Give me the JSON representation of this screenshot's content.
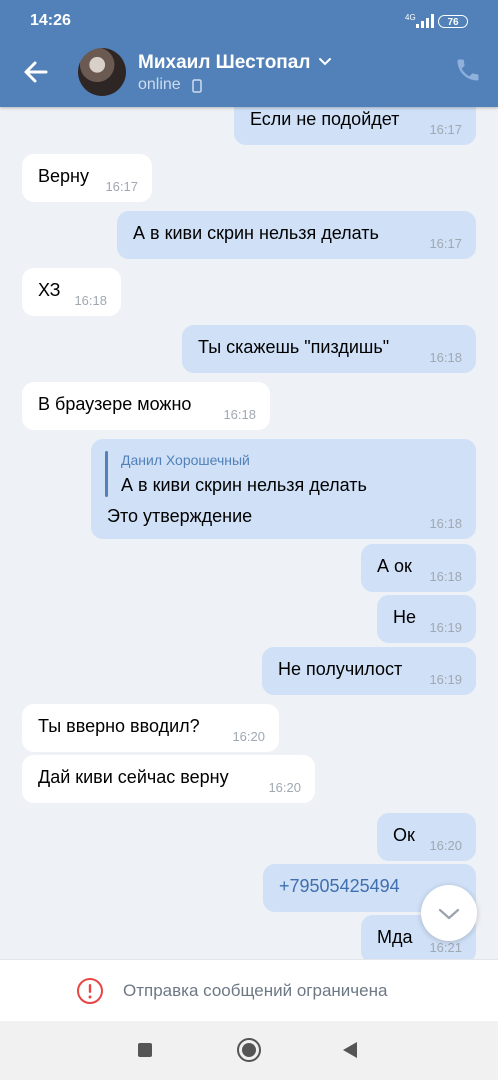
{
  "status_bar": {
    "time": "14:26",
    "network": "4G",
    "battery": "76"
  },
  "header": {
    "contact_name": "Михаил Шестопал",
    "status": "online"
  },
  "messages": [
    {
      "dir": "out",
      "text": "Если не подойдет",
      "time": "16:17"
    },
    {
      "dir": "in",
      "text": "Верну",
      "time": "16:17"
    },
    {
      "dir": "out",
      "text": "А в киви скрин нельзя делать",
      "time": "16:17"
    },
    {
      "dir": "in",
      "text": "ХЗ",
      "time": "16:18"
    },
    {
      "dir": "out",
      "text": "Ты скажешь \"пиздишь\"",
      "time": "16:18"
    },
    {
      "dir": "in",
      "text": "В браузере можно",
      "time": "16:18"
    },
    {
      "dir": "out",
      "reply_author": "Данил Хорошечный",
      "reply_text": "А в киви скрин нельзя делать",
      "text": "Это утверждение",
      "time": "16:18"
    },
    {
      "dir": "out",
      "text": "А ок",
      "time": "16:18"
    },
    {
      "dir": "out",
      "text": "Не",
      "time": "16:19"
    },
    {
      "dir": "out",
      "text": "Не получилост",
      "time": "16:19"
    },
    {
      "dir": "in",
      "text": "Ты вверно вводил?",
      "time": "16:20"
    },
    {
      "dir": "in",
      "text": "Дай киви сейчас верну",
      "time": "16:20"
    },
    {
      "dir": "out",
      "text": "Ок",
      "time": "16:20"
    },
    {
      "dir": "out",
      "text": "+79505425494",
      "time": ""
    },
    {
      "dir": "out",
      "text": "Мда",
      "time": "16:21"
    }
  ],
  "footer": {
    "restriction_text": "Отправка сообщений ограничена"
  },
  "colors": {
    "header": "#5181b8",
    "outgoing_bubble": "#cfe0f7",
    "incoming_bubble": "#ffffff",
    "link": "#5181b8"
  },
  "icons": {
    "back": "arrow-left-icon",
    "call": "phone-icon",
    "scroll": "chevron-down-icon",
    "warning": "exclamation-circle-icon"
  }
}
